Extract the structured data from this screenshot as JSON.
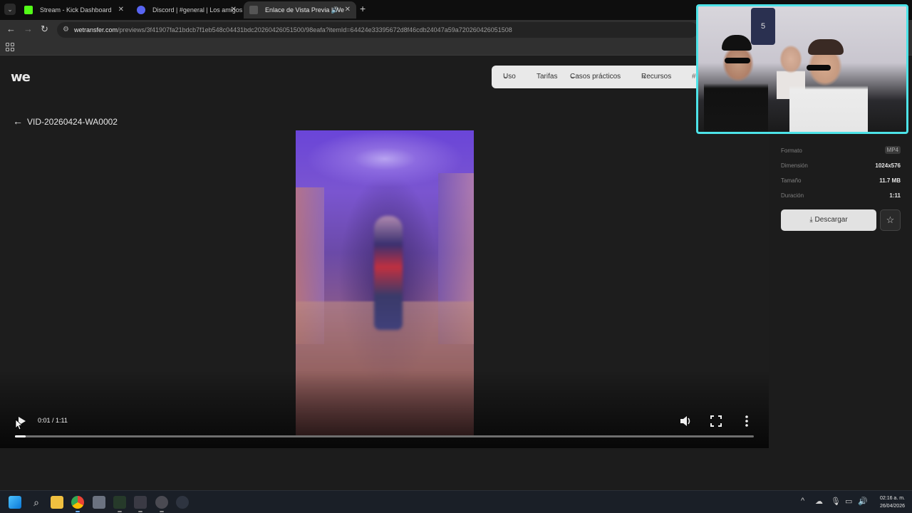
{
  "browser": {
    "tabs": [
      {
        "title": "Stream - Kick Dashboard",
        "favicon_color": "#53fc18",
        "active": false
      },
      {
        "title": "Discord | #general | Los amigos",
        "favicon_color": "#5865f2",
        "active": false
      },
      {
        "title": "Enlace de Vista Previa | We",
        "favicon_color": "#444444",
        "active": true
      }
    ],
    "url_host": "wetransfer.com",
    "url_path": "/previews/3f41907fa21bdcb7f1eb548c04431bdc20260426051500/98eafa?itemId=64424e33395672d8f46cdb24047a59a720260426051508"
  },
  "site": {
    "logo": "we",
    "nav": [
      "Uso",
      "Tarifas",
      "Casos prácticos",
      "Recursos"
    ]
  },
  "file": {
    "back_title": "VID-20260424-WA0002",
    "details": [
      {
        "label": "Formato",
        "value": "MP4"
      },
      {
        "label": "Dimensión",
        "value": "1024x576"
      },
      {
        "label": "Tamaño",
        "value": "11.7 MB"
      },
      {
        "label": "Duración",
        "value": "1:11"
      }
    ],
    "download_label": "Descargar"
  },
  "player": {
    "time": "0:01 / 1:11",
    "progress": 0.014
  },
  "webcam": {
    "jersey_number": "5"
  },
  "taskbar": {
    "time": "02:16 a. m.",
    "date": "26/04/2026"
  },
  "colors": {
    "webcam_border": "#4de3e8",
    "kick_green": "#53fc18",
    "discord_blue": "#5865f2"
  }
}
